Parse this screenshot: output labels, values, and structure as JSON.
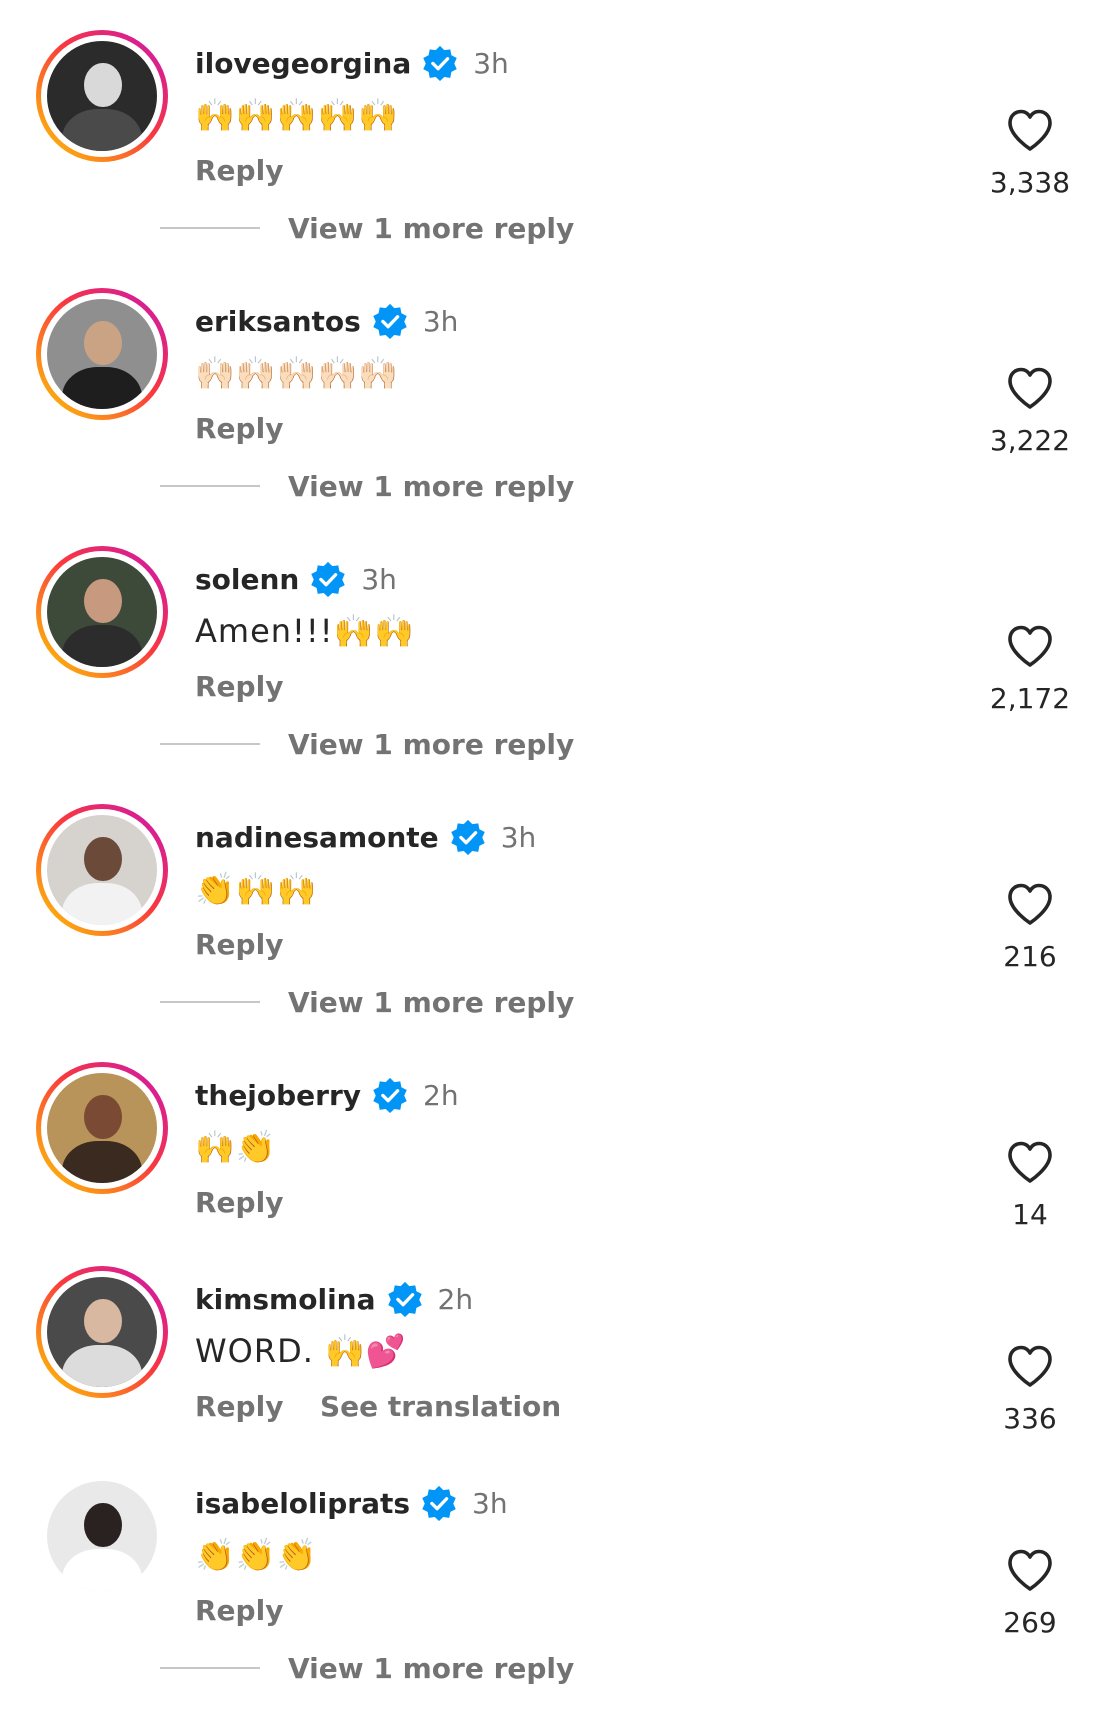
{
  "comments": [
    {
      "username": "ilovegeorgina",
      "time": "3h",
      "text": "🙌🙌🙌🙌🙌",
      "reply": "Reply",
      "likes": "3,338",
      "avatar_bg": "#2b2b2b",
      "avatar_head": "#d9d9d9",
      "avatar_body": "#4a4a4a",
      "ring": true
    },
    {
      "username": "eriksantos",
      "time": "3h",
      "text": "🙌🏻🙌🏻🙌🏻🙌🏻🙌🏻",
      "reply": "Reply",
      "likes": "3,222",
      "avatar_bg": "#8f8f8f",
      "avatar_head": "#c9a384",
      "avatar_body": "#1e1e1e",
      "ring": true
    },
    {
      "username": "solenn",
      "time": "3h",
      "text": "Amen!!!🙌🙌",
      "reply": "Reply",
      "likes": "2,172",
      "avatar_bg": "#3d4a3a",
      "avatar_head": "#c79a80",
      "avatar_body": "#2c2c2c",
      "ring": true
    },
    {
      "username": "nadinesamonte",
      "time": "3h",
      "text": "👏🙌🙌",
      "reply": "Reply",
      "likes": "216",
      "avatar_bg": "#d6d2ce",
      "avatar_head": "#6b4a3a",
      "avatar_body": "#f2f2f2",
      "ring": true
    },
    {
      "username": "thejoberry",
      "time": "2h",
      "text": "🙌👏",
      "reply": "Reply",
      "likes": "14",
      "avatar_bg": "#b8935a",
      "avatar_head": "#7a4a34",
      "avatar_body": "#3a2a20",
      "ring": true
    },
    {
      "username": "kimsmolina",
      "time": "2h",
      "text": "WORD. 🙌💕",
      "reply": "Reply",
      "translate": "See translation",
      "likes": "336",
      "avatar_bg": "#4a4a4a",
      "avatar_head": "#d8b8a0",
      "avatar_body": "#dcdcdc",
      "ring": true
    },
    {
      "username": "isabeloliprats",
      "time": "3h",
      "text": "👏👏👏",
      "reply": "Reply",
      "likes": "269",
      "avatar_bg": "#e9e9e9",
      "avatar_head": "#2a2220",
      "avatar_body": "#ffffff",
      "ring": false
    }
  ],
  "view_more_label": "View 1 more reply",
  "colors": {
    "verified": "#0095f6",
    "secondary_text": "#737373",
    "primary_text": "#262626"
  }
}
